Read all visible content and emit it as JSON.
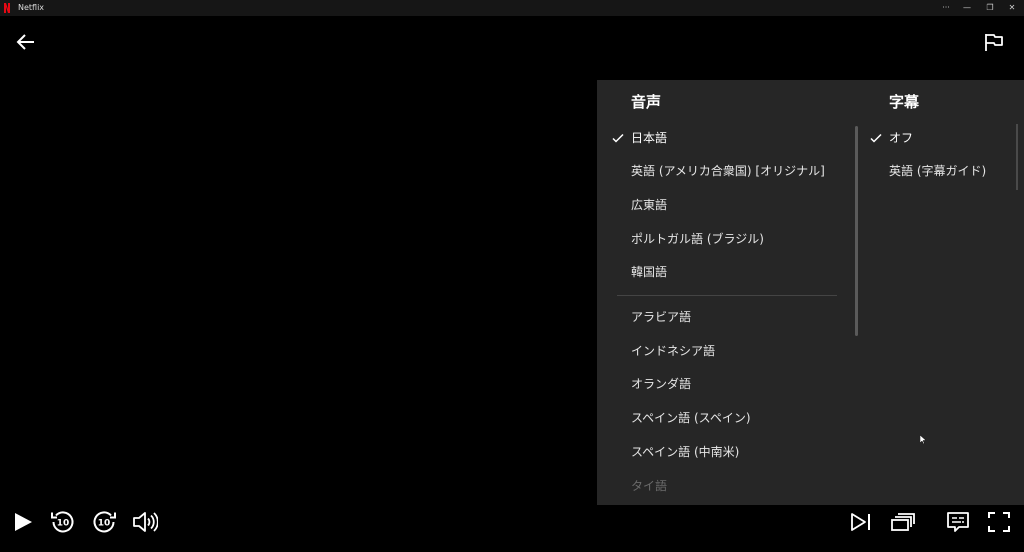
{
  "window": {
    "title": "Netflix",
    "controls": {
      "more": "···",
      "minimize": "—",
      "restore": "❐",
      "close": "✕"
    }
  },
  "player": {
    "back_icon": "arrow-left-icon",
    "report_icon": "flag-icon"
  },
  "audio_subtitle_panel": {
    "audio": {
      "title": "音声",
      "items": [
        {
          "label": "日本語",
          "selected": true
        },
        {
          "label": "英語 (アメリカ合衆国) [オリジナル]",
          "selected": false
        },
        {
          "label": "広東語",
          "selected": false
        },
        {
          "label": "ポルトガル語 (ブラジル)",
          "selected": false
        },
        {
          "label": "韓国語",
          "selected": false
        },
        {
          "label": "アラビア語",
          "selected": false
        },
        {
          "label": "インドネシア語",
          "selected": false
        },
        {
          "label": "オランダ語",
          "selected": false
        },
        {
          "label": "スペイン語 (スペイン)",
          "selected": false
        },
        {
          "label": "スペイン語 (中南米)",
          "selected": false
        },
        {
          "label": "タイ語",
          "selected": false
        }
      ]
    },
    "subtitles": {
      "title": "字幕",
      "items": [
        {
          "label": "オフ",
          "selected": true
        },
        {
          "label": "英語 (字幕ガイド)",
          "selected": false
        }
      ]
    }
  },
  "controls_bar": {
    "left": [
      "play-icon",
      "rewind-10-icon",
      "forward-10-icon",
      "volume-icon"
    ],
    "skip_labels": {
      "rewind": "10",
      "forward": "10"
    },
    "right": [
      "next-episode-icon",
      "episodes-icon",
      "audio-subtitles-icon",
      "fullscreen-icon"
    ]
  },
  "colors": {
    "background": "#000000",
    "panel": "#262626",
    "brand": "#e50914"
  }
}
